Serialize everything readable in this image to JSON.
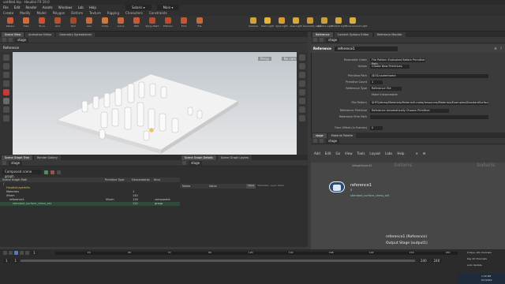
{
  "window": {
    "title": "untitled.hip - Houdini FX 19.0"
  },
  "menubar": [
    "File",
    "Edit",
    "Render",
    "Assets",
    "Windows",
    "Lab",
    "Help"
  ],
  "shelf_tabs": [
    "Create",
    "Modify",
    "Model",
    "Polygon",
    "Deform",
    "Texture",
    "Rigging",
    "Characters",
    "Constraints"
  ],
  "shelf_tools": [
    {
      "label": "Sphere",
      "color": "#c85a3a"
    },
    {
      "label": "Tube",
      "color": "#d26a3c"
    },
    {
      "label": "Torus",
      "color": "#c75238"
    },
    {
      "label": "Grid",
      "color": "#b65032"
    },
    {
      "label": "Null",
      "color": "#a04a30"
    },
    {
      "label": "Line",
      "color": "#c46a40"
    },
    {
      "label": "Circle",
      "color": "#d0783a"
    },
    {
      "label": "Curve",
      "color": "#c6663a"
    },
    {
      "label": "Path",
      "color": "#c45a36"
    },
    {
      "label": "Spray Paint",
      "color": "#b84c30"
    },
    {
      "label": "Platonic",
      "color": "#b84c30"
    },
    {
      "label": "Font",
      "color": "#c05838"
    },
    {
      "label": "File",
      "color": "#c06a3a"
    }
  ],
  "light_tools": [
    {
      "label": "Camera",
      "color": "#d0a23a"
    },
    {
      "label": "Point Light",
      "color": "#e2b43c"
    },
    {
      "label": "Spot Light",
      "color": "#d89a34"
    },
    {
      "label": "Area Light",
      "color": "#d4a83a"
    },
    {
      "label": "Geometry Light",
      "color": "#c99a36"
    },
    {
      "label": "Volume Light",
      "color": "#c9a03a"
    },
    {
      "label": "Distant Light",
      "color": "#d2a83c"
    },
    {
      "label": "Environment Light",
      "color": "#d8b040"
    }
  ],
  "left_pane": {
    "tabs": [
      "Scene View",
      "Animation Editor",
      "Geometry Spreadsheet"
    ],
    "path": "stage",
    "viewport_label": "Reference",
    "persp": "Persp",
    "cam": "No cam"
  },
  "right_pane": {
    "tabs": [
      "Reference",
      "Content Options Editor",
      "Reference Monitor"
    ],
    "path": "stage",
    "node_type": "Reference",
    "node_name": "reference1",
    "params": [
      {
        "label": "Parameter Order",
        "value": "File Pattern Evaluated Before Primitive Path"
      },
      {
        "label": "Action",
        "value": "Create New Primitives"
      },
      {
        "label": "Primitive Path",
        "value": "/$OS/usdrefname"
      },
      {
        "label": "Primitive Count",
        "value": "1"
      },
      {
        "label": "Reference Type",
        "value": "Reference File"
      },
      {
        "label": "",
        "value": "Make Instanceable"
      },
      {
        "label": "File Pattern",
        "value": "$HFS/demo/Materials/MaterialX-meta/resources/Materials/Examples/StandardSurface/standard_surface_chess_set"
      },
      {
        "label": "Reference Primitive",
        "value": "Reference Automatically Chosen Primitive"
      },
      {
        "label": "Reference Prim Path",
        "value": ""
      },
      {
        "label": "Time Offset (in Frames)",
        "value": "0"
      }
    ]
  },
  "net_pane": {
    "tabs": [
      "stage",
      "Material Palette"
    ],
    "path": "stage",
    "menus": [
      "Add",
      "Edit",
      "Go",
      "View",
      "Tools",
      "Layout",
      "Labs",
      "Help"
    ],
    "watermark1": "Solaris",
    "watermark2": "Solaris",
    "top_node": "/stage/layout1",
    "node_name": "reference1",
    "node_sub": "standard_surface_chess_set",
    "node_count": "5",
    "caption_line1": "reference1 (Reference)",
    "caption_line2": "Output Stage (output1)"
  },
  "scene_tree": {
    "tabs": [
      "Scene Graph Tree",
      "Render Gallery"
    ],
    "path": "stage",
    "filter": "Composed scene graph",
    "columns": [
      "Scene Graph Path",
      "Primitive Type",
      "Descendants",
      "Kind"
    ],
    "rows": [
      {
        "path": "/",
        "type": "",
        "desc": "",
        "kind": ""
      },
      {
        "path": "HoudiniLayerInfo",
        "type": "",
        "desc": "",
        "kind": ""
      },
      {
        "path": "Materials",
        "type": "",
        "desc": "1",
        "kind": ""
      },
      {
        "path": "Xform",
        "type": "",
        "desc": "140",
        "kind": ""
      },
      {
        "path": "reference1",
        "type": "Xform",
        "desc": "116",
        "kind": "component"
      },
      {
        "path": "standard_surface_chess_set",
        "type": "",
        "desc": "112",
        "kind": "group"
      }
    ]
  },
  "scene_detail": {
    "tabs": [
      "Scene Graph Details",
      "Scene Graph Layers"
    ],
    "path": "stage",
    "columns": [
      "Name",
      "Value"
    ],
    "side_tabs": [
      "Value",
      "Metadata",
      "Layer Stack"
    ]
  },
  "timeline": {
    "frame": "1",
    "start": "1",
    "end": "240",
    "end2": "240",
    "ticks": [
      "24",
      "48",
      "72",
      "96",
      "120",
      "144",
      "168",
      "192",
      "216",
      "240"
    ],
    "keys_label": "0 keys, 0/0 channels",
    "key_all": "Key All Channels",
    "auto_update": "Auto Update"
  },
  "taskbar": {
    "time": "1:30 PM",
    "date": "6/7/2022"
  }
}
